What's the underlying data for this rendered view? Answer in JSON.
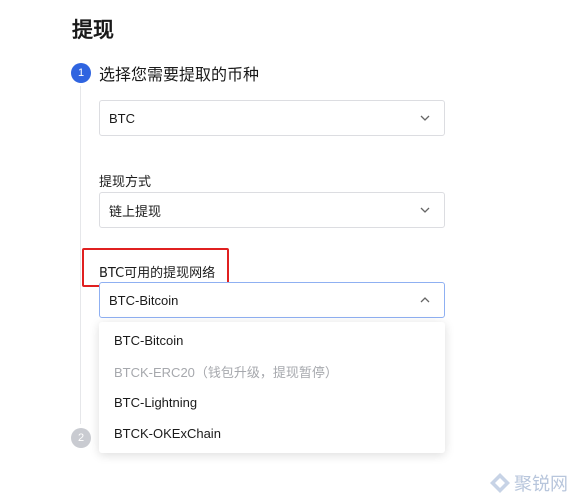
{
  "page": {
    "title": "提现"
  },
  "step1": {
    "number": "1",
    "label": "选择您需要提取的币种"
  },
  "currency_select": {
    "value": "BTC",
    "icon": "chevron-down-icon"
  },
  "method": {
    "label": "提现方式",
    "value": "链上提现",
    "icon": "chevron-down-icon"
  },
  "network": {
    "label": "BTC可用的提现网络",
    "value": "BTC-Bitcoin",
    "icon": "chevron-up-icon",
    "options": [
      {
        "label": "BTC-Bitcoin",
        "disabled": false
      },
      {
        "label": "BTCK-ERC20（钱包升级，提现暂停）",
        "disabled": true
      },
      {
        "label": "BTC-Lightning",
        "disabled": false
      },
      {
        "label": "BTCK-OKExChain",
        "disabled": false
      }
    ]
  },
  "step2": {
    "number": "2"
  },
  "watermark": {
    "text": "聚锐网"
  },
  "colors": {
    "accent": "#2f64e0",
    "highlight": "#e02020",
    "disabled_text": "#a6a8ad"
  }
}
